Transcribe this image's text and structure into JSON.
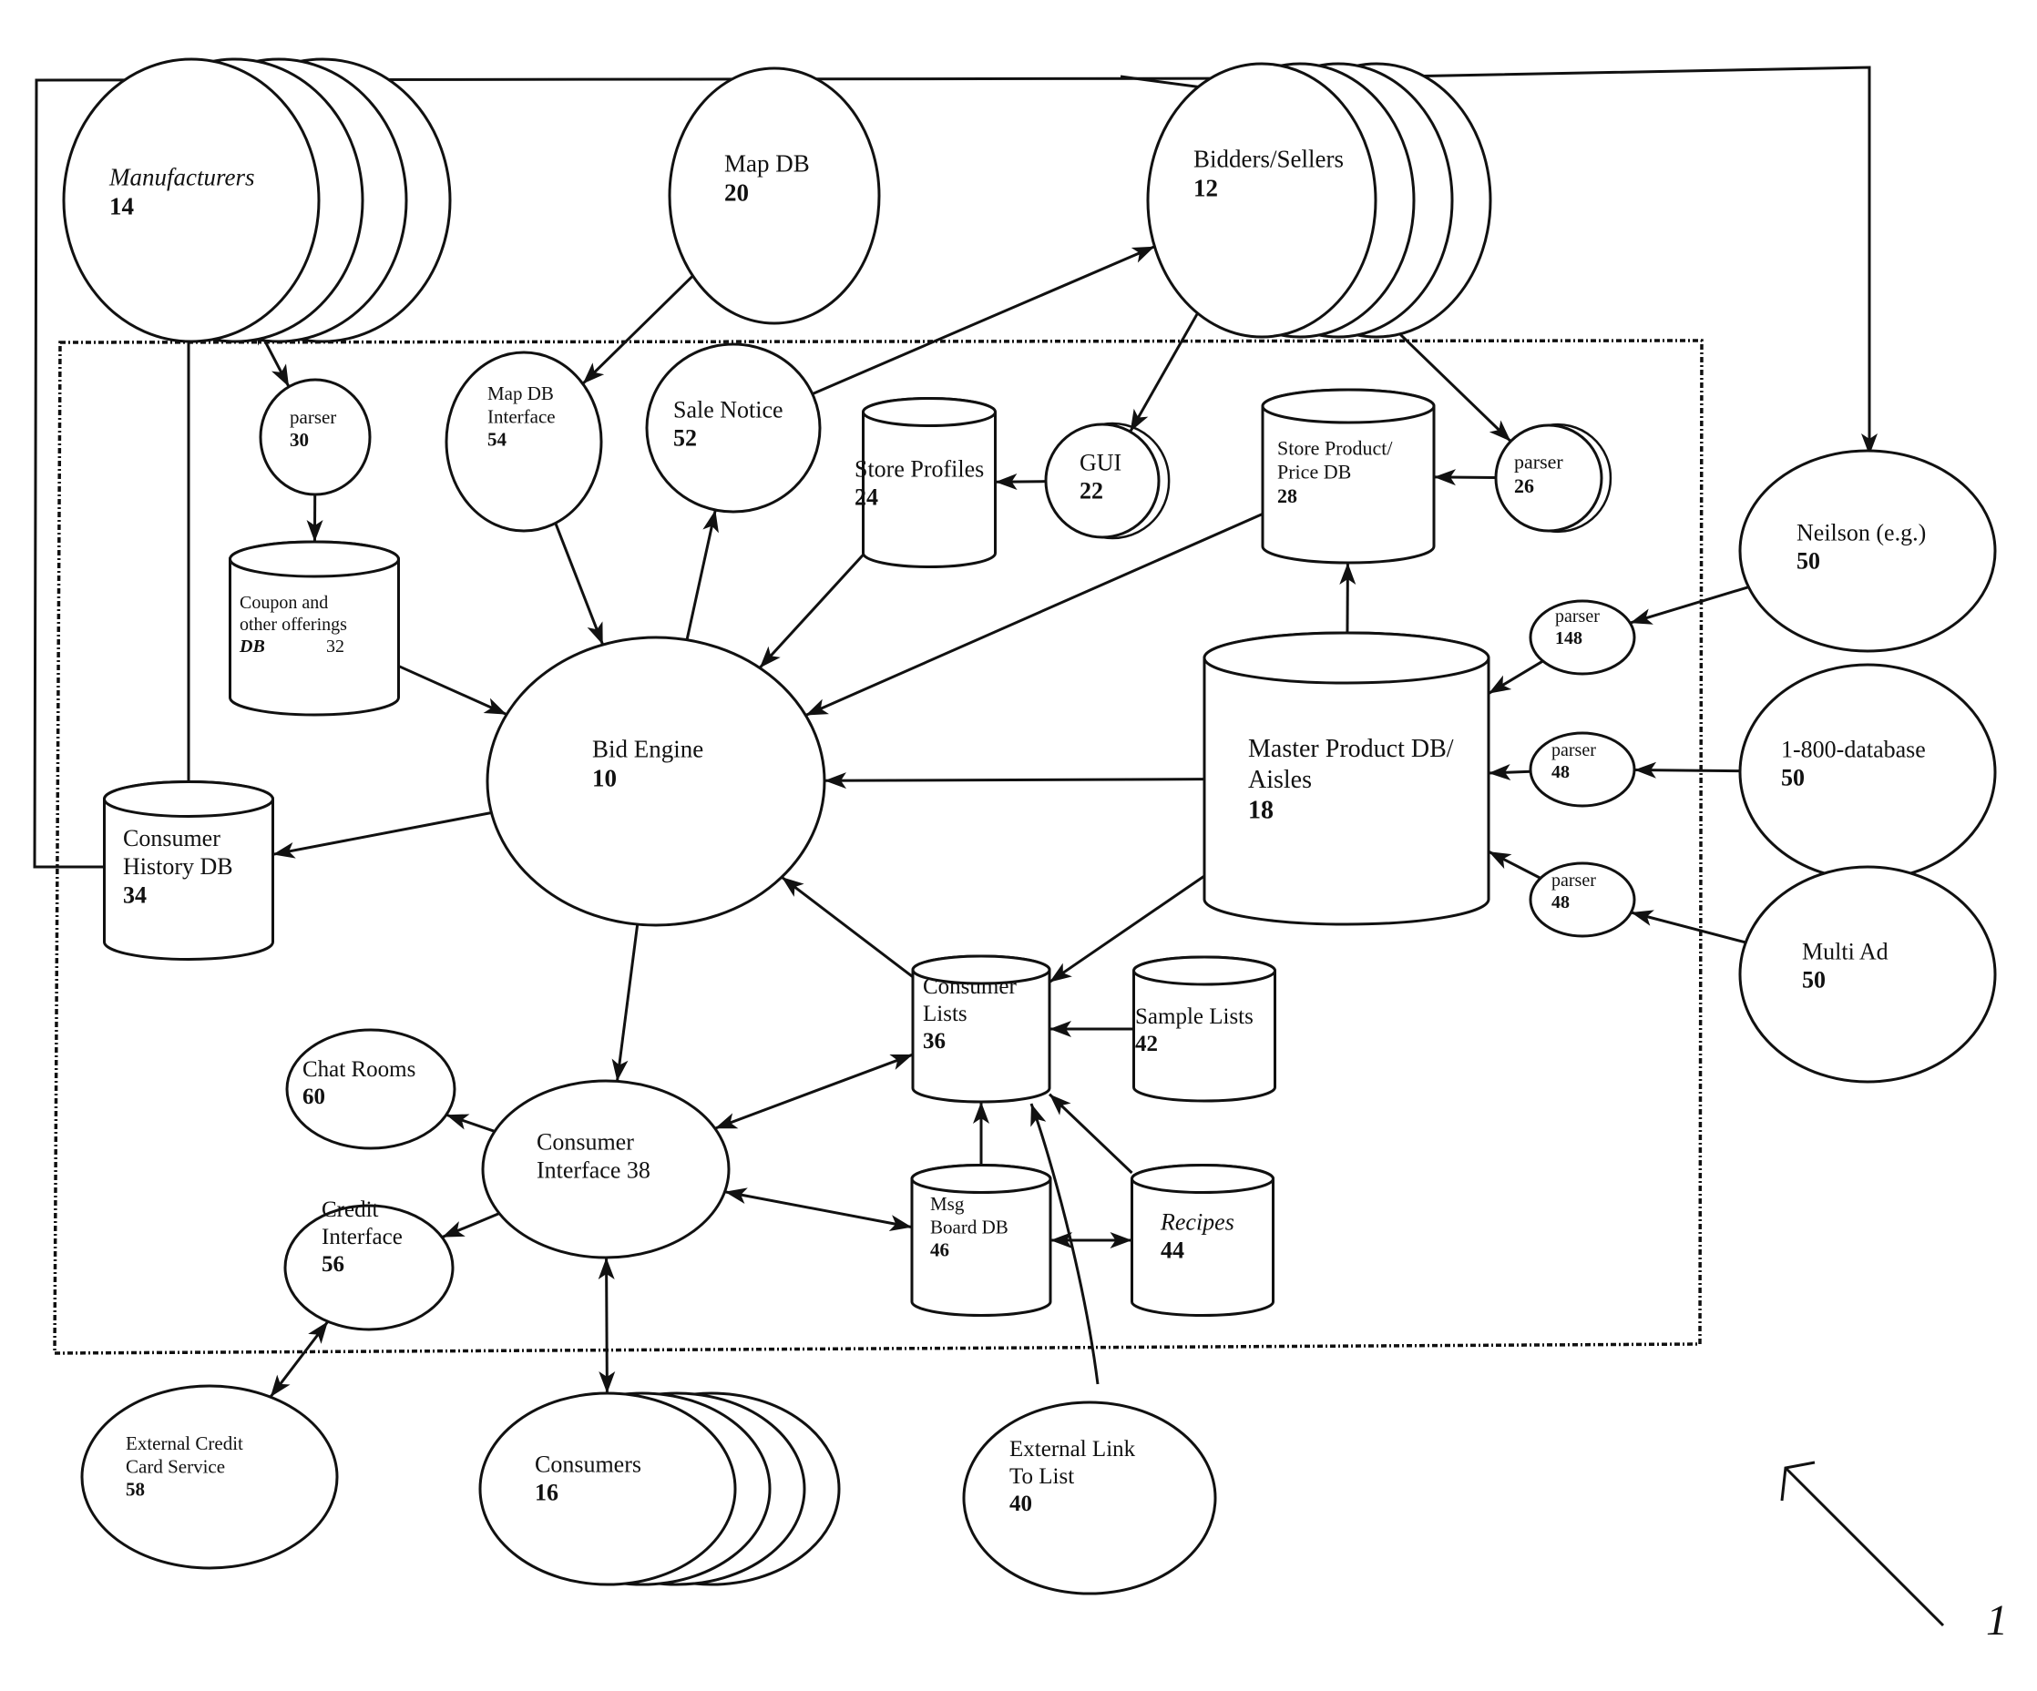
{
  "figure": {
    "reference_numeral": "1",
    "nodes": {
      "manufacturers": {
        "label": "Manufacturers",
        "number": "14",
        "italic": true
      },
      "map_db": {
        "label": "Map DB",
        "number": "20"
      },
      "bidders_sellers": {
        "label": "Bidders/Sellers",
        "number": "12"
      },
      "parser_30": {
        "label": "parser",
        "number": "30"
      },
      "map_db_interface": {
        "label_lines": [
          "Map DB",
          "Interface"
        ],
        "number": "54"
      },
      "sale_notice": {
        "label": "Sale Notice",
        "number": "52"
      },
      "store_profiles": {
        "label": "Store Profiles",
        "number": "24"
      },
      "gui": {
        "label": "GUI",
        "number": "22"
      },
      "store_product_price_db": {
        "label_lines": [
          "Store Product/",
          "Price DB"
        ],
        "number": "28"
      },
      "parser_26": {
        "label": "parser",
        "number": "26"
      },
      "neilson": {
        "label": "Neilson (e.g.)",
        "number": "50"
      },
      "coupon_db": {
        "label_lines": [
          "Coupon and",
          "other offerings"
        ],
        "label_suffix": "DB",
        "number": "32"
      },
      "bid_engine": {
        "label": "Bid Engine",
        "number": "10"
      },
      "parser_48_a": {
        "label": "parser",
        "number": "148"
      },
      "master_product_db": {
        "label_lines": [
          "Master Product DB/",
          "Aisles"
        ],
        "number": "18"
      },
      "parser_48_b": {
        "label": "parser",
        "number": "48"
      },
      "parser_48_c": {
        "label": "parser",
        "number": "48"
      },
      "db_1800": {
        "label": "1-800-database",
        "number": "50"
      },
      "multi_ad": {
        "label": "Multi Ad",
        "number": "50"
      },
      "consumer_history_db": {
        "label_lines": [
          "Consumer",
          "History DB"
        ],
        "number": "34"
      },
      "consumer_lists": {
        "label_lines": [
          "Consumer",
          "Lists"
        ],
        "number": "36"
      },
      "sample_lists": {
        "label": "Sample Lists",
        "number": "42"
      },
      "chat_rooms": {
        "label": "Chat Rooms",
        "number": "60"
      },
      "consumer_interface": {
        "label_lines": [
          "Consumer",
          "Interface 38"
        ]
      },
      "credit_interface": {
        "label_lines": [
          "Credit",
          "Interface"
        ],
        "number": "56"
      },
      "msg_board_db": {
        "label_lines": [
          "Msg",
          "Board DB"
        ],
        "number": "46"
      },
      "recipes": {
        "label": "Recipes",
        "number": "44",
        "italic": true
      },
      "external_credit": {
        "label_lines": [
          "External Credit",
          "Card Service"
        ],
        "number": "58"
      },
      "consumers": {
        "label": "Consumers",
        "number": "16"
      },
      "external_link": {
        "label_lines": [
          "External Link",
          "To List"
        ],
        "number": "40"
      }
    },
    "edges": [
      {
        "from": "manufacturers",
        "to": "parser_30",
        "type": "double-arrow"
      },
      {
        "from": "parser_30",
        "to": "coupon_db",
        "type": "arrow"
      },
      {
        "from": "map_db",
        "to": "map_db_interface",
        "type": "arrow"
      },
      {
        "from": "sale_notice",
        "to": "bidders_sellers",
        "type": "arrow"
      },
      {
        "from": "bidders_sellers",
        "to": "gui",
        "type": "arrow"
      },
      {
        "from": "bidders_sellers",
        "to": "parser_26",
        "type": "arrow"
      },
      {
        "from": "gui",
        "to": "store_profiles",
        "type": "arrow"
      },
      {
        "from": "parser_26",
        "to": "store_product_price_db",
        "type": "arrow"
      },
      {
        "from": "master_product_db",
        "to": "store_product_price_db",
        "type": "arrow"
      },
      {
        "from": "coupon_db",
        "to": "bid_engine",
        "type": "arrow"
      },
      {
        "from": "map_db_interface",
        "to": "bid_engine",
        "type": "arrow"
      },
      {
        "from": "bid_engine",
        "to": "sale_notice",
        "type": "arrow"
      },
      {
        "from": "store_profiles",
        "to": "bid_engine",
        "type": "arrow"
      },
      {
        "from": "store_product_price_db",
        "to": "bid_engine",
        "type": "arrow"
      },
      {
        "from": "master_product_db",
        "to": "bid_engine",
        "type": "arrow"
      },
      {
        "from": "consumer_lists",
        "to": "bid_engine",
        "type": "arrow"
      },
      {
        "from": "master_product_db",
        "to": "consumer_lists",
        "type": "arrow"
      },
      {
        "from": "bid_engine",
        "to": "consumer_history_db",
        "type": "arrow"
      },
      {
        "from": "consumer_history_db",
        "to": "manufacturers",
        "type": "arrow"
      },
      {
        "from": "consumer_history_db",
        "to": "bidders_sellers",
        "type": "arrow"
      },
      {
        "from": "neilson",
        "to": "parser_48_a",
        "type": "arrow"
      },
      {
        "from": "db_1800",
        "to": "parser_48_b",
        "type": "arrow"
      },
      {
        "from": "multi_ad",
        "to": "parser_48_c",
        "type": "arrow"
      },
      {
        "from": "parser_48_a",
        "to": "master_product_db",
        "type": "arrow"
      },
      {
        "from": "parser_48_b",
        "to": "master_product_db",
        "type": "arrow"
      },
      {
        "from": "parser_48_c",
        "to": "master_product_db",
        "type": "arrow"
      },
      {
        "from": "bid_engine",
        "to": "consumer_interface",
        "type": "arrow"
      },
      {
        "from": "consumer_interface",
        "to": "consumer_lists",
        "type": "double-arrow"
      },
      {
        "from": "consumer_interface",
        "to": "msg_board_db",
        "type": "double-arrow"
      },
      {
        "from": "consumer_interface",
        "to": "chat_rooms",
        "type": "arrow"
      },
      {
        "from": "consumer_interface",
        "to": "credit_interface",
        "type": "arrow"
      },
      {
        "from": "consumer_interface",
        "to": "consumers",
        "type": "double-arrow"
      },
      {
        "from": "credit_interface",
        "to": "external_credit",
        "type": "double-arrow"
      },
      {
        "from": "sample_lists",
        "to": "consumer_lists",
        "type": "arrow"
      },
      {
        "from": "recipes",
        "to": "consumer_lists",
        "type": "arrow"
      },
      {
        "from": "msg_board_db",
        "to": "consumer_lists",
        "type": "arrow"
      },
      {
        "from": "msg_board_db",
        "to": "recipes",
        "type": "double-arrow"
      },
      {
        "from": "external_link",
        "to": "consumer_lists",
        "type": "arrow"
      }
    ]
  }
}
